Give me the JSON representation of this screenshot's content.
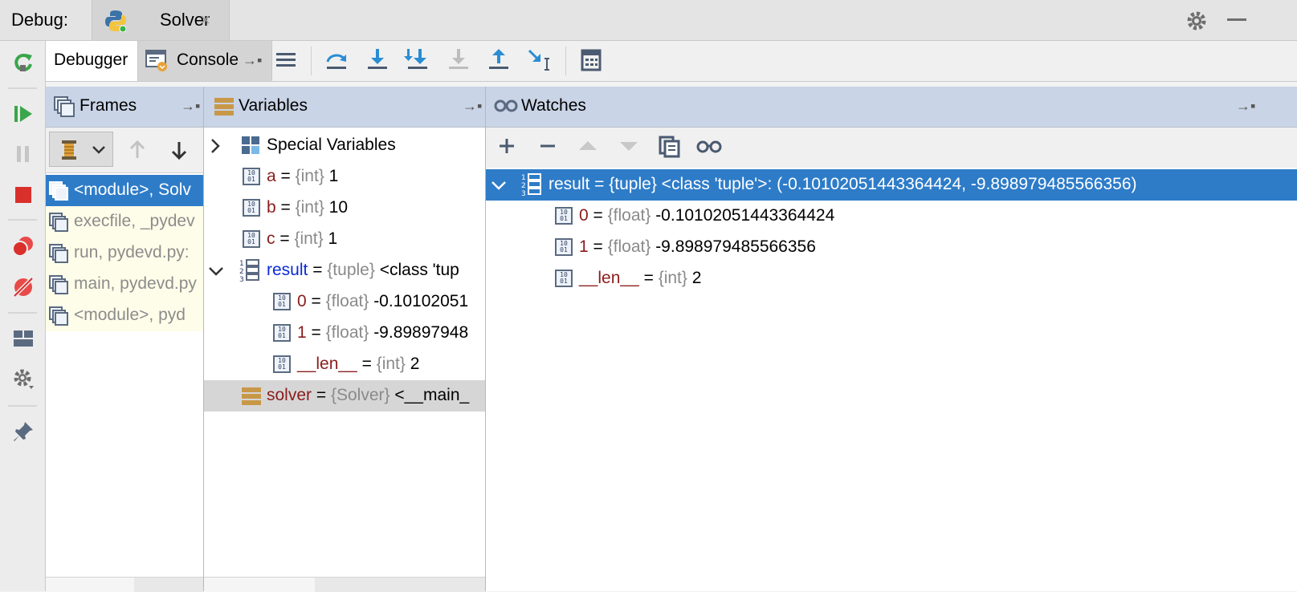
{
  "top": {
    "debug_label": "Debug:",
    "tab_title": "Solver",
    "tab_close": "×"
  },
  "tabs": {
    "debugger": "Debugger",
    "console": "Console"
  },
  "panels": {
    "frames": "Frames",
    "variables": "Variables",
    "watches": "Watches"
  },
  "frames": [
    {
      "label": "<module>, Solv",
      "selected": true
    },
    {
      "label": "execfile, _pydev",
      "selected": false
    },
    {
      "label": "run, pydevd.py:",
      "selected": false
    },
    {
      "label": "main, pydevd.py",
      "selected": false
    },
    {
      "label": "<module>, pyd",
      "selected": false
    }
  ],
  "variables": {
    "special": "Special Variables",
    "a": {
      "name": "a",
      "eq": " = ",
      "type": "{int}",
      "value": " 1"
    },
    "b": {
      "name": "b",
      "eq": " = ",
      "type": "{int}",
      "value": " 10"
    },
    "c": {
      "name": "c",
      "eq": " = ",
      "type": "{int}",
      "value": " 1"
    },
    "result": {
      "name": "result",
      "eq": " = ",
      "type": "{tuple}",
      "value": " <class 'tup"
    },
    "r0": {
      "name": "0",
      "eq": " = ",
      "type": "{float}",
      "value": " -0.10102051"
    },
    "r1": {
      "name": "1",
      "eq": " = ",
      "type": "{float}",
      "value": " -9.89897948"
    },
    "rlen": {
      "name": "__len__",
      "eq": " = ",
      "type": "{int}",
      "value": " 2"
    },
    "solver": {
      "name": "solver",
      "eq": " = ",
      "type": "{Solver}",
      "value": " <__main_"
    }
  },
  "watches": {
    "result": "result = {tuple} <class 'tuple'>: (-0.10102051443364424, -9.898979485566356)",
    "w0": {
      "name": "0",
      "eq": " = ",
      "type": "{float}",
      "value": " -0.10102051443364424"
    },
    "w1": {
      "name": "1",
      "eq": " = ",
      "type": "{float}",
      "value": " -9.898979485566356"
    },
    "wlen": {
      "name": "__len__",
      "eq": " = ",
      "type": "{int}",
      "value": " 2"
    }
  },
  "colors": {
    "selection": "#2e7cc8",
    "panel_header": "#c9d4e6",
    "frame_bg": "#fefde9",
    "var_name": "#8b1c1c"
  }
}
